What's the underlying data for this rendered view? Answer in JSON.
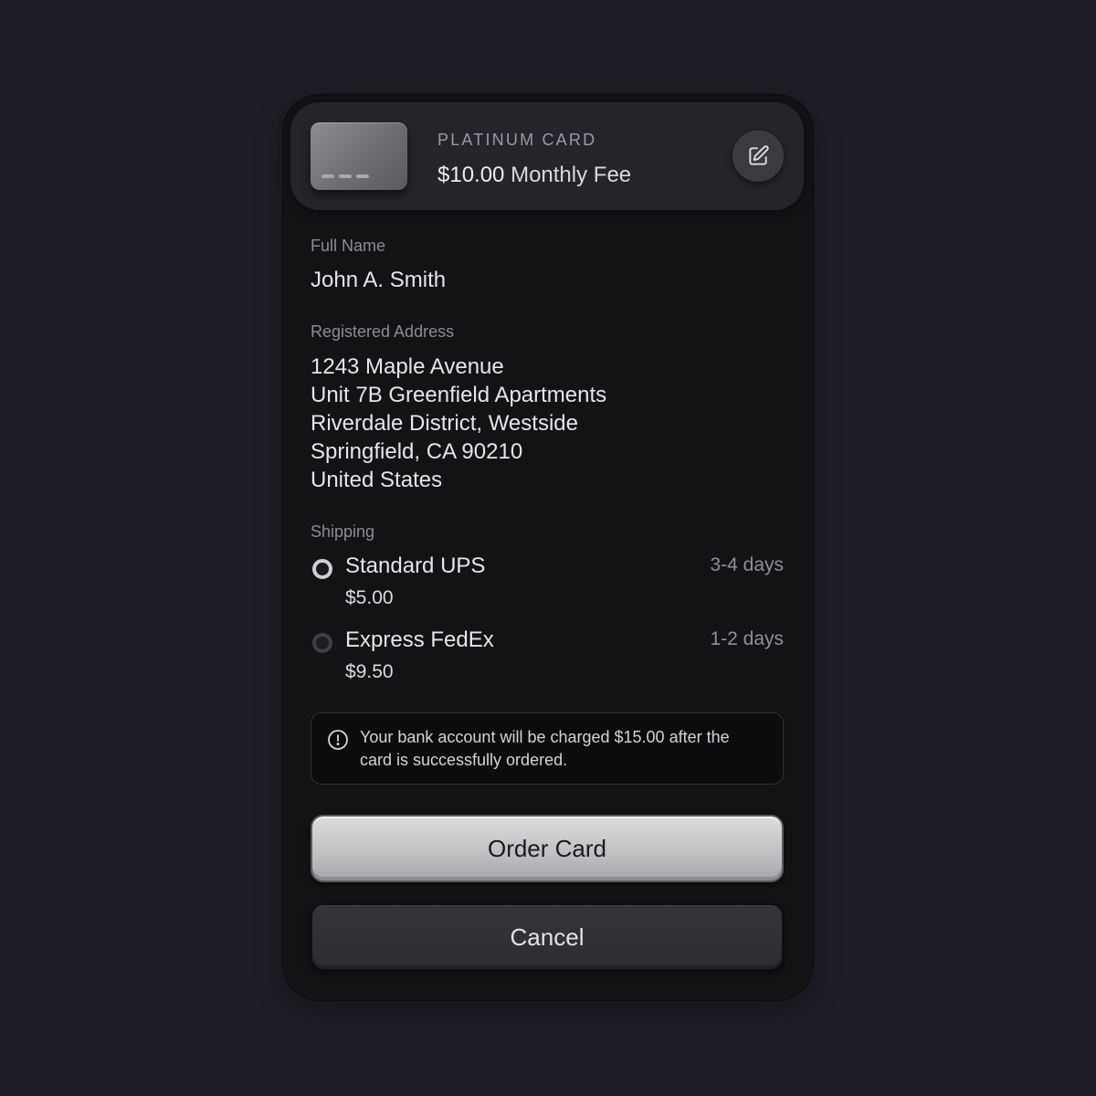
{
  "card": {
    "type_label": "PLATINUM CARD",
    "fee_amount": "$10.00",
    "fee_label": "Monthly Fee",
    "edit_icon": "edit-pencil-icon"
  },
  "full_name": {
    "label": "Full Name",
    "value": "John A. Smith"
  },
  "address": {
    "label": "Registered Address",
    "lines": [
      "1243 Maple Avenue",
      "Unit 7B Greenfield Apartments",
      "Riverdale District, Westside",
      "Springfield, CA 90210",
      "United States"
    ]
  },
  "shipping": {
    "label": "Shipping",
    "options": [
      {
        "name": "Standard UPS",
        "price": "$5.00",
        "time": "3-4 days",
        "selected": true
      },
      {
        "name": "Express FedEx",
        "price": "$9.50",
        "time": "1-2 days",
        "selected": false
      }
    ]
  },
  "notice": {
    "icon": "info-circle-icon",
    "text": "Your bank account will be charged $15.00 after the card is successfully ordered."
  },
  "actions": {
    "primary_label": "Order Card",
    "secondary_label": "Cancel"
  },
  "colors": {
    "background": "#1e1e26",
    "panel": "#131316",
    "header": "#24242a",
    "primary_button": "#c2c2c5",
    "secondary_button": "#2c2c32"
  }
}
